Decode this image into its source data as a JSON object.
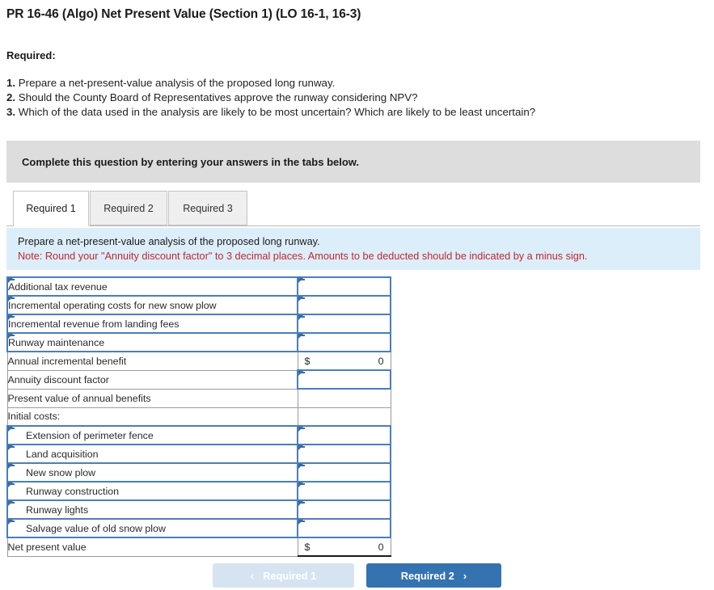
{
  "header": {
    "title": "PR 16-46 (Algo) Net Present Value (Section 1) (LO 16-1, 16-3)",
    "required_label": "Required:"
  },
  "requirements": [
    {
      "num": "1.",
      "text": "Prepare a net-present-value analysis of the proposed long runway."
    },
    {
      "num": "2.",
      "text": "Should the County Board of Representatives approve the runway considering NPV?"
    },
    {
      "num": "3.",
      "text": "Which of the data used in the analysis are likely to be most uncertain? Which are likely to be least uncertain?"
    }
  ],
  "banner": {
    "text": "Complete this question by entering your answers in the tabs below."
  },
  "tabs": [
    {
      "label": "Required 1",
      "active": true
    },
    {
      "label": "Required 2",
      "active": false
    },
    {
      "label": "Required 3",
      "active": false
    }
  ],
  "note": {
    "line1": "Prepare a net-present-value analysis of the proposed long runway.",
    "line2": "Note: Round your \"Annuity discount factor\" to 3 decimal places. Amounts to be deducted should be indicated by a minus sign."
  },
  "worksheet": {
    "rows": [
      {
        "label": "Additional tax revenue",
        "label_type": "input",
        "indent": false,
        "value_type": "input",
        "symbol": "",
        "value": ""
      },
      {
        "label": "Incremental operating costs for new snow plow",
        "label_type": "input",
        "indent": false,
        "value_type": "input",
        "symbol": "",
        "value": ""
      },
      {
        "label": "Incremental revenue from landing fees",
        "label_type": "input",
        "indent": false,
        "value_type": "input",
        "symbol": "",
        "value": ""
      },
      {
        "label": "Runway maintenance",
        "label_type": "input",
        "indent": false,
        "value_type": "input",
        "symbol": "",
        "value": ""
      },
      {
        "label": "Annual incremental benefit",
        "label_type": "plain",
        "indent": false,
        "value_type": "total",
        "symbol": "$",
        "value": "0"
      },
      {
        "label": "Annuity discount factor",
        "label_type": "plain",
        "indent": false,
        "value_type": "input",
        "symbol": "",
        "value": ""
      },
      {
        "label": "Present value of annual benefits",
        "label_type": "plain",
        "indent": false,
        "value_type": "blank",
        "symbol": "",
        "value": ""
      },
      {
        "label": "Initial costs:",
        "label_type": "plain",
        "indent": false,
        "value_type": "blank",
        "symbol": "",
        "value": ""
      },
      {
        "label": "Extension of perimeter fence",
        "label_type": "input",
        "indent": true,
        "value_type": "input",
        "symbol": "",
        "value": ""
      },
      {
        "label": "Land acquisition",
        "label_type": "input",
        "indent": true,
        "value_type": "input",
        "symbol": "",
        "value": ""
      },
      {
        "label": "New snow plow",
        "label_type": "input",
        "indent": true,
        "value_type": "input",
        "symbol": "",
        "value": ""
      },
      {
        "label": "Runway construction",
        "label_type": "input",
        "indent": true,
        "value_type": "input",
        "symbol": "",
        "value": ""
      },
      {
        "label": "Runway lights",
        "label_type": "input",
        "indent": true,
        "value_type": "input",
        "symbol": "",
        "value": ""
      },
      {
        "label": "Salvage value of old snow plow",
        "label_type": "input",
        "indent": true,
        "value_type": "input",
        "symbol": "",
        "value": ""
      },
      {
        "label": "Net present value",
        "label_type": "plain",
        "indent": false,
        "value_type": "total-bottom",
        "symbol": "$",
        "value": "0"
      }
    ]
  },
  "footer": {
    "prev_label": "Required 1",
    "prev_icon": "chevron-left-icon",
    "prev_chevron": "‹",
    "next_label": "Required 2",
    "next_icon": "chevron-right-icon",
    "next_chevron": "›"
  },
  "colors": {
    "banner_bg": "#dddddd",
    "note_bg": "#ddeefb",
    "note_warning_text": "#c0282d",
    "input_border": "#4a7ebb",
    "primary_button": "#3572b0",
    "disabled_button": "#d6e4f2"
  }
}
